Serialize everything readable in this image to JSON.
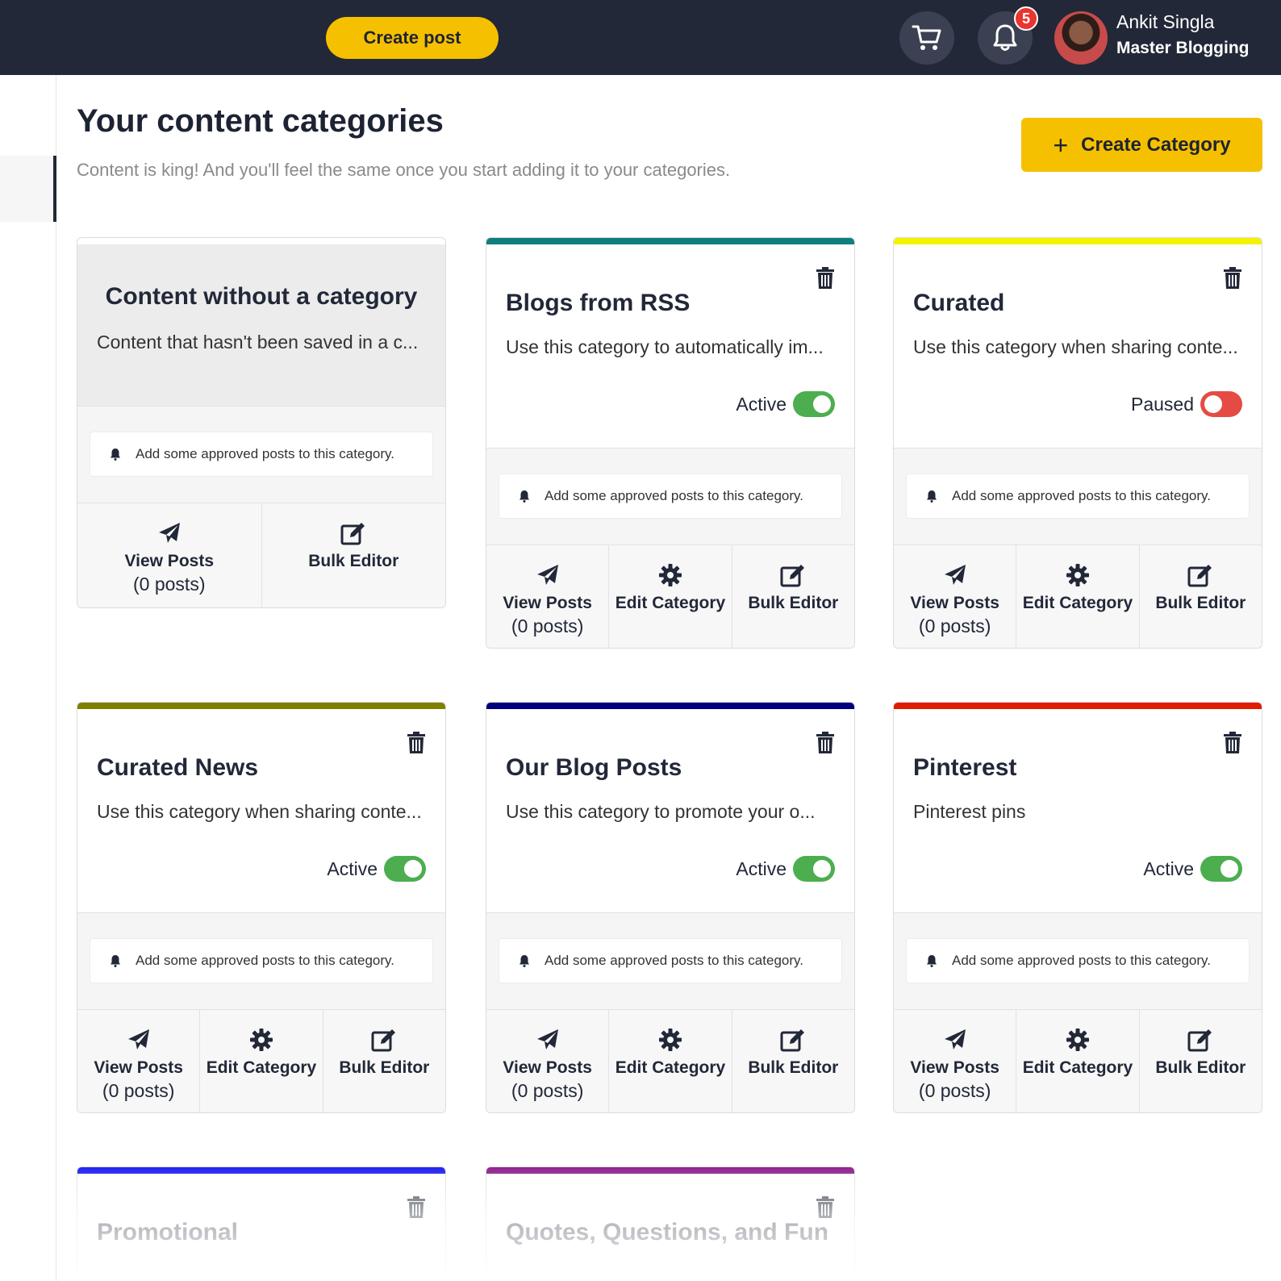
{
  "topbar": {
    "create_post_label": "Create post",
    "notification_count": "5",
    "user_name": "Ankit Singla",
    "user_org": "Master Blogging"
  },
  "header": {
    "title": "Your content categories",
    "subtitle": "Content is king! And you'll feel the same once you start adding it to your categories.",
    "create_category_label": "Create Category"
  },
  "uncategorized": {
    "title": "Content without a category",
    "description": "Content that hasn't been saved in a c...",
    "notice": "Add some approved posts to this category.",
    "view_posts_label": "View Posts",
    "post_count": "(0 posts)",
    "bulk_editor_label": "Bulk Editor"
  },
  "categories": [
    {
      "title": "Blogs from RSS",
      "description": "Use this category to automatically im...",
      "status": "Active",
      "color": "#0e7f7f",
      "notice": "Add some approved posts to this category.",
      "view_posts": "View Posts",
      "post_count": "(0 posts)",
      "edit": "Edit Category",
      "bulk": "Bulk Editor"
    },
    {
      "title": "Curated",
      "description": "Use this category when sharing conte...",
      "status": "Paused",
      "color": "#f5f200",
      "notice": "Add some approved posts to this category.",
      "view_posts": "View Posts",
      "post_count": "(0 posts)",
      "edit": "Edit Category",
      "bulk": "Bulk Editor"
    },
    {
      "title": "Curated News",
      "description": "Use this category when sharing conte...",
      "status": "Active",
      "color": "#7f7f00",
      "notice": "Add some approved posts to this category.",
      "view_posts": "View Posts",
      "post_count": "(0 posts)",
      "edit": "Edit Category",
      "bulk": "Bulk Editor"
    },
    {
      "title": "Our Blog Posts",
      "description": "Use this category to promote your o...",
      "status": "Active",
      "color": "#00007f",
      "notice": "Add some approved posts to this category.",
      "view_posts": "View Posts",
      "post_count": "(0 posts)",
      "edit": "Edit Category",
      "bulk": "Bulk Editor"
    },
    {
      "title": "Pinterest",
      "description": "Pinterest pins",
      "status": "Active",
      "color": "#e01b00",
      "notice": "Add some approved posts to this category.",
      "view_posts": "View Posts",
      "post_count": "(0 posts)",
      "edit": "Edit Category",
      "bulk": "Bulk Editor"
    },
    {
      "title": "Promotional",
      "color": "#0000ee"
    },
    {
      "title": "Quotes, Questions, and Fun",
      "color": "#7f007f"
    }
  ]
}
